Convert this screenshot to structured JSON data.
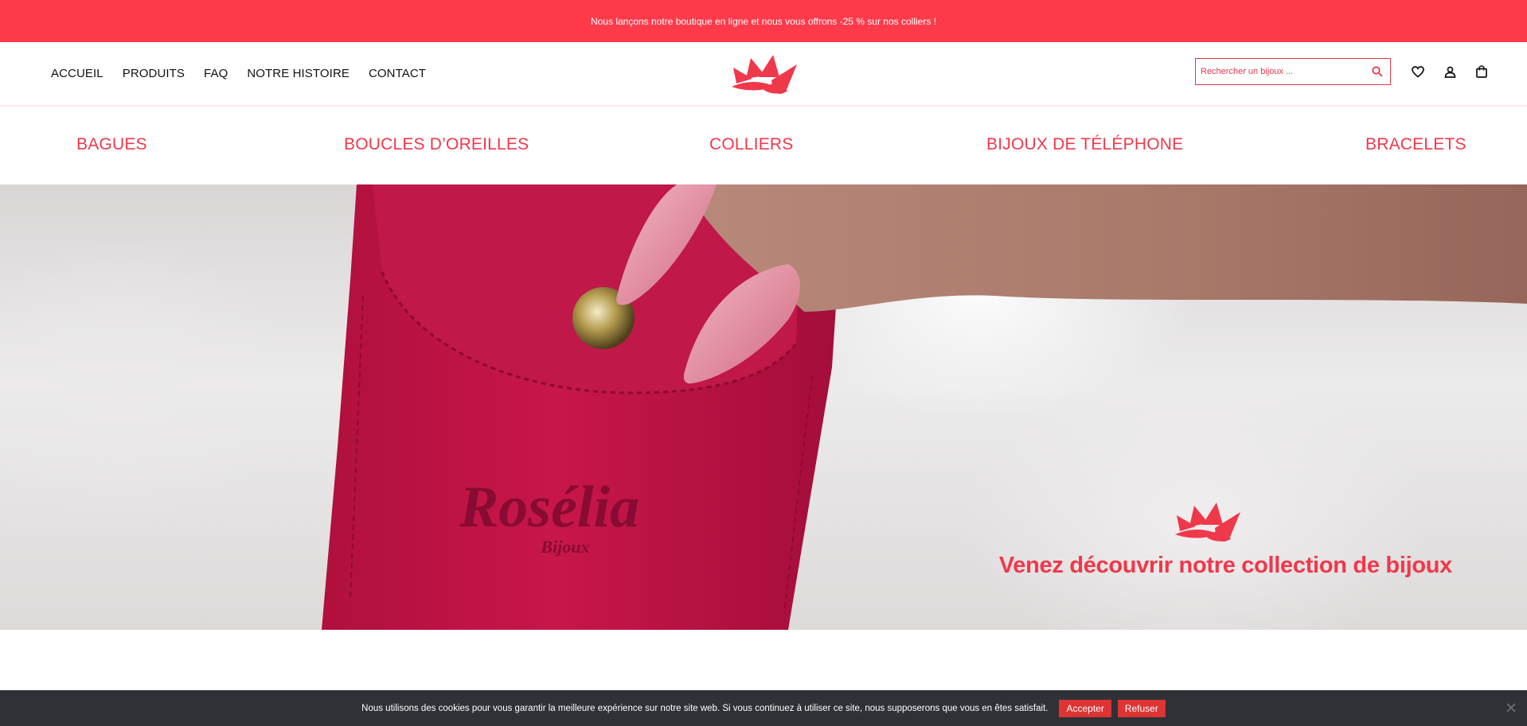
{
  "announcement": "Nous lançons notre boutique en ligne et nous vous offrons -25 % sur nos colliers !",
  "nav": [
    "ACCUEIL",
    "PRODUITS",
    "FAQ",
    "NOTRE HISTOIRE",
    "CONTACT"
  ],
  "search": {
    "placeholder": "Rechercher un bijoux ..."
  },
  "header_icons": [
    "heart-icon",
    "user-icon",
    "bag-icon"
  ],
  "categories": [
    "BAGUES",
    "BOUCLES D’OREILLES",
    "COLLIERS",
    "BIJOUX DE TÉLÉPHONE",
    "BRACELETS"
  ],
  "hero": {
    "pouch_brand": "Rosélia",
    "pouch_sub": "Bijoux",
    "title": "Venez découvrir notre collection de bijoux"
  },
  "cookie": {
    "text": "Nous utilisons des cookies pour vous garantir la meilleure expérience sur notre site web. Si vous continuez à utiliser ce site, nous supposerons que vous en êtes satisfait.",
    "accept": "Accepter",
    "refuse": "Refuser"
  },
  "colors": {
    "brand": "#ff3a4a",
    "category": "#f0384b",
    "cookie_bg": "#2f3136"
  }
}
